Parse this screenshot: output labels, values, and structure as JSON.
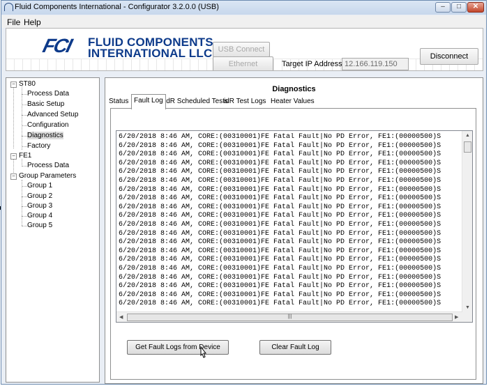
{
  "window": {
    "title": "Fluid Components International - Configurator 3.2.0.0 (USB)",
    "minimize_symbol": "–",
    "maximize_symbol": "□",
    "close_symbol": "✕"
  },
  "menu": [
    "File",
    "Help"
  ],
  "header": {
    "logo_mark": "FCI",
    "logo_line1": "FLUID COMPONENTS",
    "logo_line2": "INTERNATIONAL LLC",
    "usb_connect": "USB Connect",
    "ethernet_connect": "Ethernet Connect",
    "target_ip_label": "Target IP Address:",
    "target_ip_value": "12.166.119.150",
    "disconnect": "Disconnect"
  },
  "tree": {
    "st80": "ST80",
    "process_data": "Process Data",
    "basic_setup": "Basic Setup",
    "advanced_setup": "Advanced Setup",
    "configuration": "Configuration",
    "diagnostics": "Diagnostics",
    "factory": "Factory",
    "fe1": "FE1",
    "fe1_process_data": "Process Data",
    "group_parameters": "Group Parameters",
    "groups": [
      "Group 1",
      "Group 2",
      "Group 3",
      "Group 4",
      "Group 5"
    ],
    "expander_symbol": "−"
  },
  "panel": {
    "title": "Diagnostics",
    "tabs": [
      "Status",
      "Fault Log",
      "idR Scheduled Tests",
      "idR Test Logs",
      "Heater Values"
    ],
    "active_tab": "Fault Log"
  },
  "fault_log": {
    "lines": [
      "6/20/2018 8:46 AM, CORE:(00310001)FE Fatal Fault|No PD Error, FE1:(00000500)S",
      "6/20/2018 8:46 AM, CORE:(00310001)FE Fatal Fault|No PD Error, FE1:(00000500)S",
      "6/20/2018 8:46 AM, CORE:(00310001)FE Fatal Fault|No PD Error, FE1:(00000500)S",
      "6/20/2018 8:46 AM, CORE:(00310001)FE Fatal Fault|No PD Error, FE1:(00000500)S",
      "6/20/2018 8:46 AM, CORE:(00310001)FE Fatal Fault|No PD Error, FE1:(00000500)S",
      "6/20/2018 8:46 AM, CORE:(00310001)FE Fatal Fault|No PD Error, FE1:(00000500)S",
      "6/20/2018 8:46 AM, CORE:(00310001)FE Fatal Fault|No PD Error, FE1:(00000500)S",
      "6/20/2018 8:46 AM, CORE:(00310001)FE Fatal Fault|No PD Error, FE1:(00000500)S",
      "6/20/2018 8:46 AM, CORE:(00310001)FE Fatal Fault|No PD Error, FE1:(00000500)S",
      "6/20/2018 8:46 AM, CORE:(00310001)FE Fatal Fault|No PD Error, FE1:(00000500)S",
      "6/20/2018 8:46 AM, CORE:(00310001)FE Fatal Fault|No PD Error, FE1:(00000500)S",
      "6/20/2018 8:46 AM, CORE:(00310001)FE Fatal Fault|No PD Error, FE1:(00000500)S",
      "6/20/2018 8:46 AM, CORE:(00310001)FE Fatal Fault|No PD Error, FE1:(00000500)S",
      "6/20/2018 8:46 AM, CORE:(00310001)FE Fatal Fault|No PD Error, FE1:(00000500)S",
      "6/20/2018 8:46 AM, CORE:(00310001)FE Fatal Fault|No PD Error, FE1:(00000500)S",
      "6/20/2018 8:46 AM, CORE:(00310001)FE Fatal Fault|No PD Error, FE1:(00000500)S",
      "6/20/2018 8:46 AM, CORE:(00310001)FE Fatal Fault|No PD Error, FE1:(00000500)S",
      "6/20/2018 8:46 AM, CORE:(00310001)FE Fatal Fault|No PD Error, FE1:(00000500)S",
      "6/20/2018 8:46 AM, CORE:(00310001)FE Fatal Fault|No PD Error, FE1:(00000500)S",
      "6/20/2018 8:46 AM, CORE:(00310001)FE Fatal Fault|No PD Error, FE1:(00000500)S"
    ],
    "get_button": "Get Fault Logs from Device",
    "clear_button": "Clear Fault Log"
  },
  "colors": {
    "logo_blue": "#0d3a8a",
    "close_red": "#c2462b",
    "frame_blue": "#6c8bb0"
  },
  "icons": [
    "app-icon",
    "minimize-icon",
    "maximize-icon",
    "close-icon",
    "scroll-up-icon",
    "scroll-down-icon",
    "scroll-left-icon",
    "scroll-right-icon",
    "mouse-cursor-icon"
  ]
}
